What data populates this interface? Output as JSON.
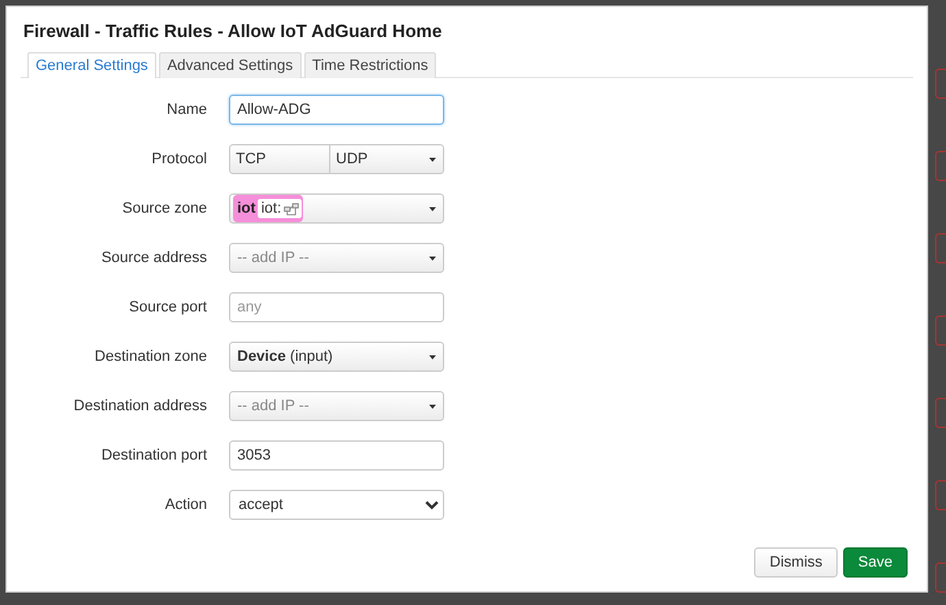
{
  "window": {
    "title": "Firewall - Traffic Rules - Allow IoT AdGuard Home"
  },
  "tabs": [
    {
      "label": "General Settings",
      "selected": true
    },
    {
      "label": "Advanced Settings",
      "selected": false
    },
    {
      "label": "Time Restrictions",
      "selected": false
    }
  ],
  "fields": [
    {
      "label": "Name",
      "kind": "text",
      "value": "Allow-ADG",
      "focused": true
    },
    {
      "label": "Protocol",
      "kind": "multi",
      "values": [
        "TCP",
        "UDP"
      ]
    },
    {
      "label": "Source zone",
      "kind": "zone",
      "zone": "iot",
      "chip": "iot:",
      "color": "#f58fd9"
    },
    {
      "label": "Source address",
      "kind": "dropdown",
      "placeholder": "-- add IP --"
    },
    {
      "label": "Source port",
      "kind": "text",
      "placeholder": "any",
      "focused": false
    },
    {
      "label": "Destination zone",
      "kind": "dropdown",
      "value": "**Device** (input)"
    },
    {
      "label": "Destination address",
      "kind": "dropdown",
      "placeholder": "-- add IP --"
    },
    {
      "label": "Destination port",
      "kind": "text",
      "value": "3053",
      "focused": false
    },
    {
      "label": "Action",
      "kind": "select",
      "value": "accept"
    }
  ],
  "buttons": [
    {
      "label": "Dismiss",
      "kind": "default"
    },
    {
      "label": "Save",
      "kind": "primary"
    }
  ]
}
